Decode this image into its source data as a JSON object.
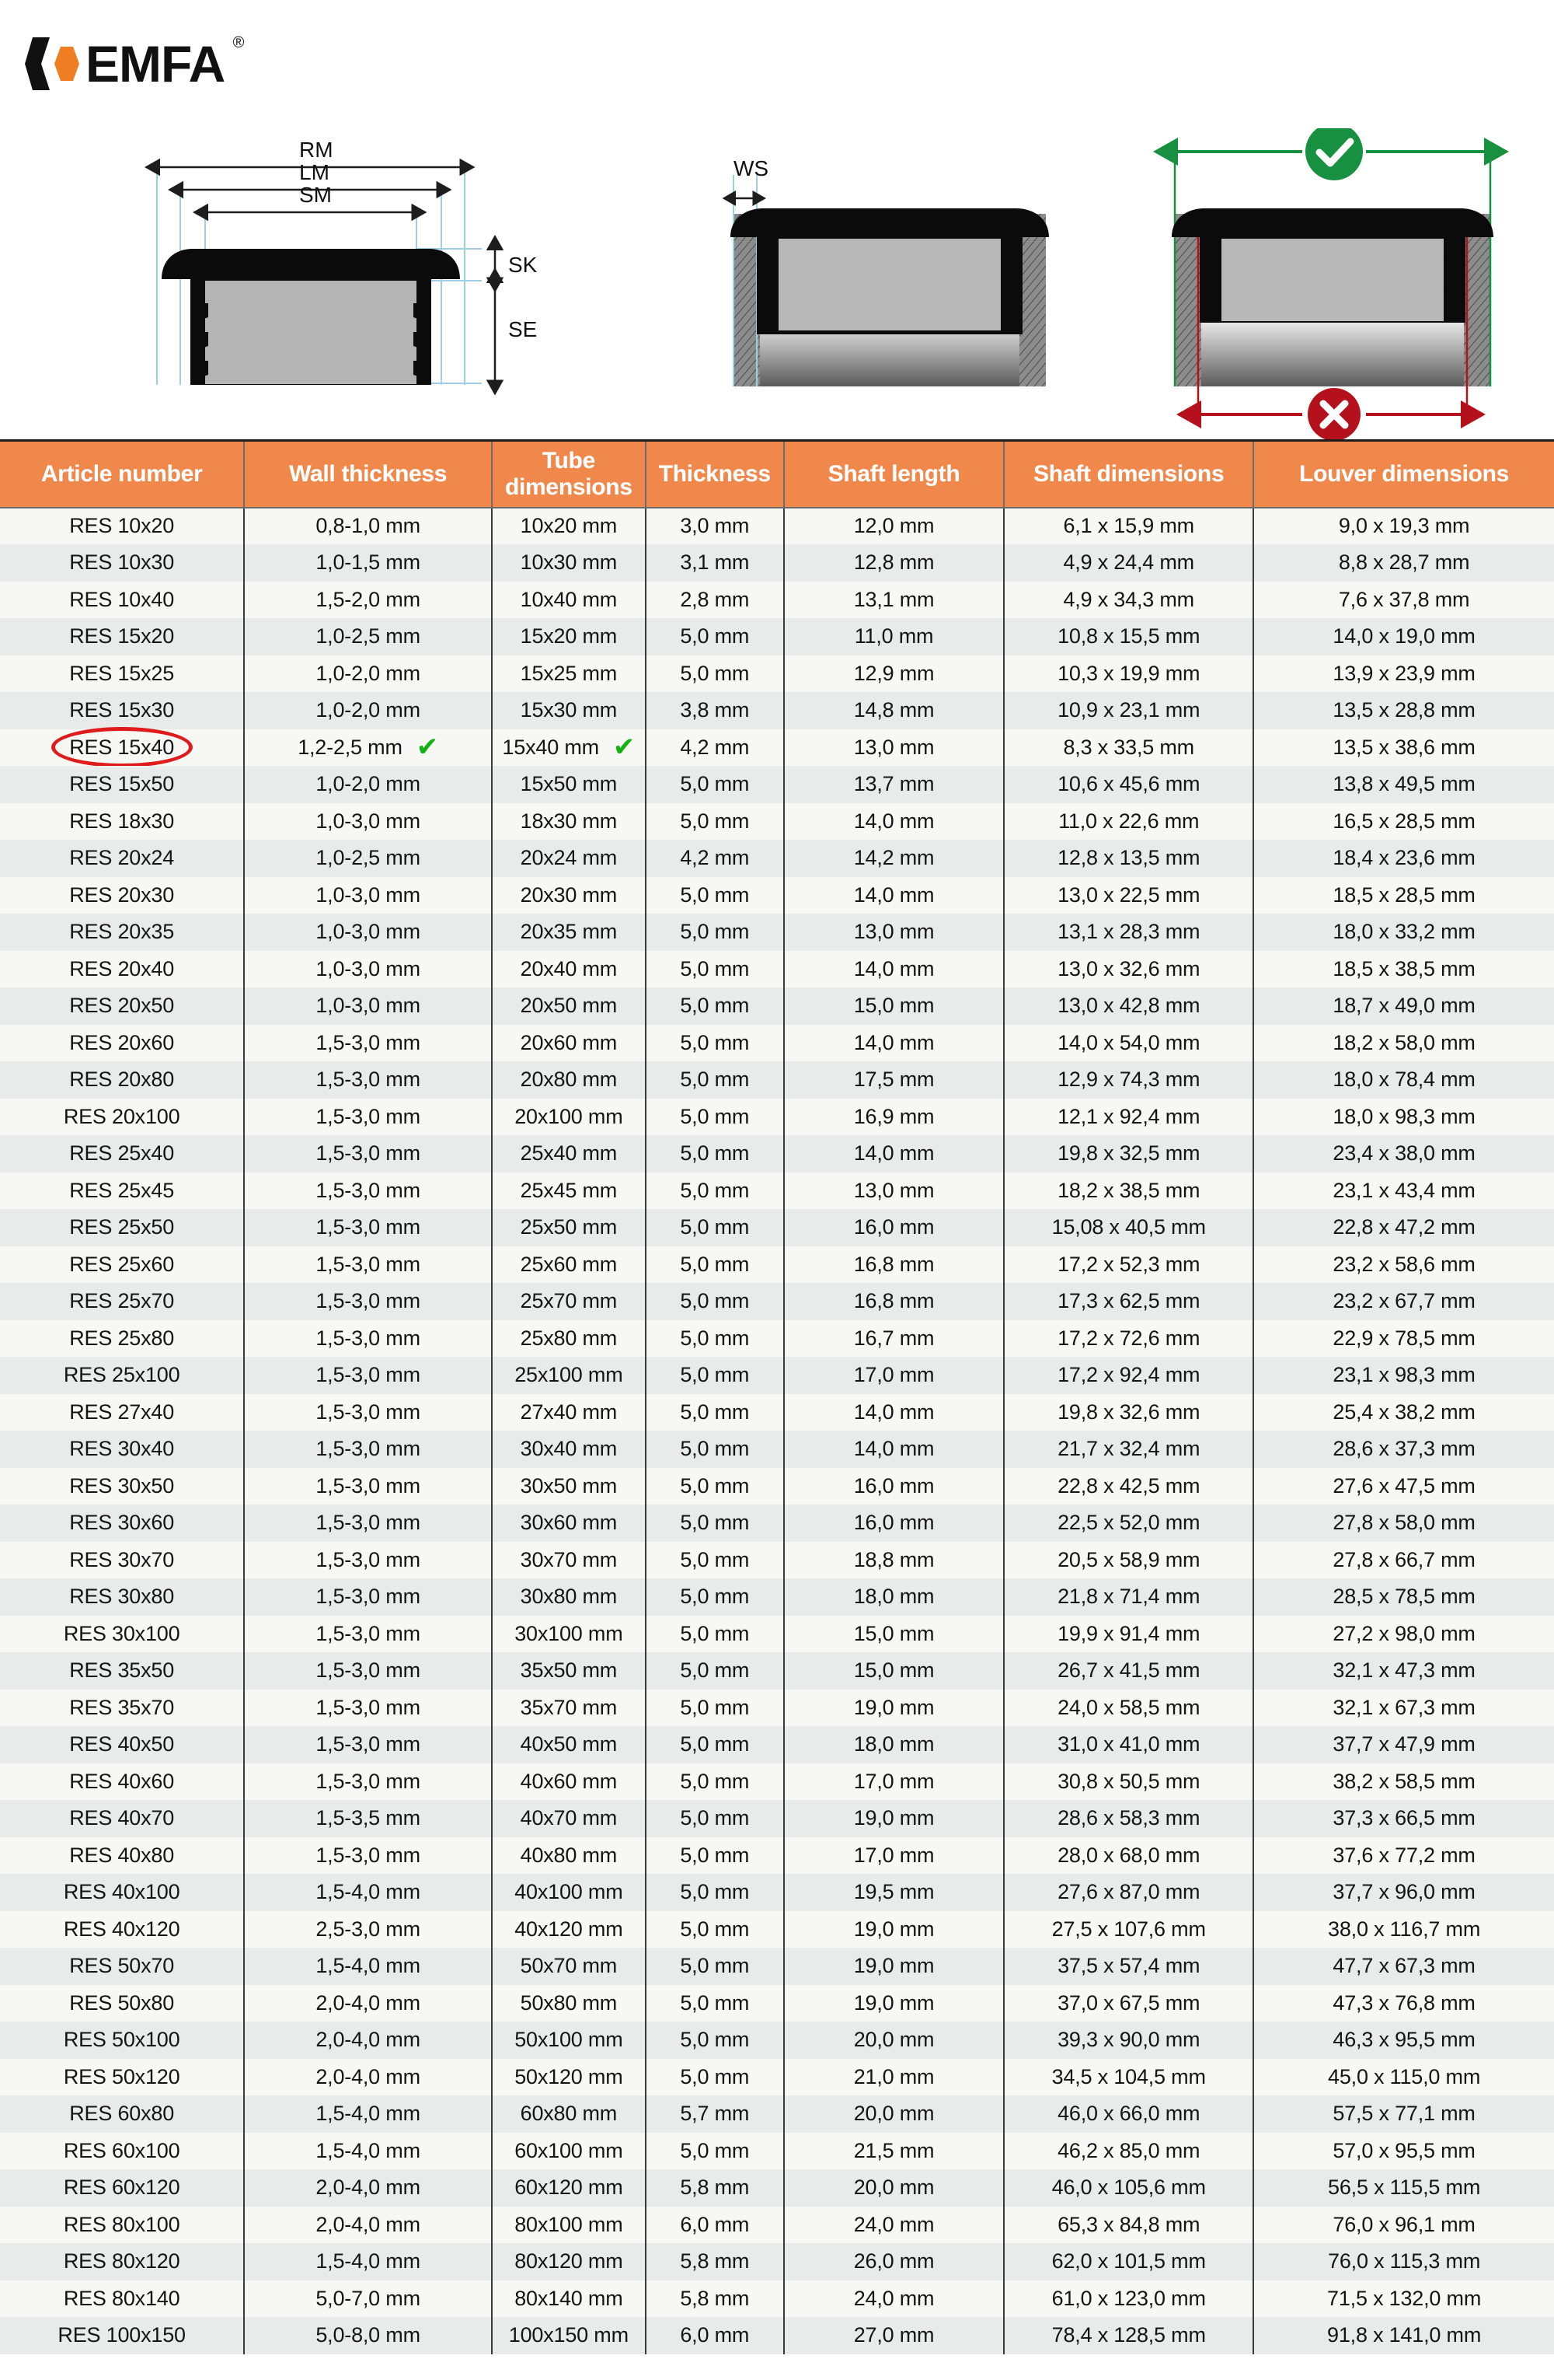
{
  "brand": {
    "name": "EMFA",
    "registered_mark": "®",
    "logo_icon": "emfa-hexagon-logo",
    "accent_color": "#f0884c",
    "logo_orange": "#ef7d22"
  },
  "diagrams": {
    "side_view": {
      "name": "cross-section-side-view",
      "labels": [
        "RM",
        "LM",
        "SM",
        "SK",
        "SE"
      ]
    },
    "wall_view": {
      "name": "wall-thickness-view",
      "labels": [
        "WS"
      ]
    },
    "fit_view": {
      "name": "correct-incorrect-measurement-view",
      "ok_icon": "green-check-circle-icon",
      "ok_color": "#1a8a3c",
      "not_ok_icon": "red-cross-circle-icon",
      "not_ok_color": "#b4111d",
      "labels": []
    }
  },
  "table": {
    "columns": [
      "Article number",
      "Wall thickness",
      "Tube dimensions",
      "Thickness",
      "Shaft length",
      "Shaft dimensions",
      "Louver dimensions"
    ],
    "highlight": {
      "article": "RES 15x40",
      "marker": "red-ellipse",
      "marker_color": "#e01b1b",
      "check_mark": "✔",
      "check_color": "#13b213",
      "checked_columns": [
        "Wall thickness",
        "Tube dimensions"
      ]
    },
    "rows": [
      [
        "RES 10x20",
        "0,8-1,0 mm",
        "10x20 mm",
        "3,0 mm",
        "12,0 mm",
        "6,1 x 15,9 mm",
        "9,0 x 19,3 mm"
      ],
      [
        "RES 10x30",
        "1,0-1,5 mm",
        "10x30 mm",
        "3,1 mm",
        "12,8 mm",
        "4,9 x 24,4 mm",
        "8,8 x 28,7 mm"
      ],
      [
        "RES 10x40",
        "1,5-2,0 mm",
        "10x40 mm",
        "2,8 mm",
        "13,1 mm",
        "4,9 x 34,3 mm",
        "7,6 x 37,8 mm"
      ],
      [
        "RES 15x20",
        "1,0-2,5 mm",
        "15x20 mm",
        "5,0 mm",
        "11,0 mm",
        "10,8 x 15,5 mm",
        "14,0 x 19,0 mm"
      ],
      [
        "RES 15x25",
        "1,0-2,0 mm",
        "15x25 mm",
        "5,0 mm",
        "12,9 mm",
        "10,3 x 19,9 mm",
        "13,9 x 23,9 mm"
      ],
      [
        "RES 15x30",
        "1,0-2,0 mm",
        "15x30 mm",
        "3,8 mm",
        "14,8 mm",
        "10,9 x 23,1 mm",
        "13,5 x 28,8 mm"
      ],
      [
        "RES 15x40",
        "1,2-2,5 mm",
        "15x40 mm",
        "4,2 mm",
        "13,0 mm",
        "8,3 x 33,5 mm",
        "13,5 x 38,6 mm"
      ],
      [
        "RES 15x50",
        "1,0-2,0 mm",
        "15x50 mm",
        "5,0 mm",
        "13,7 mm",
        "10,6 x 45,6 mm",
        "13,8 x 49,5 mm"
      ],
      [
        "RES 18x30",
        "1,0-3,0 mm",
        "18x30 mm",
        "5,0 mm",
        "14,0 mm",
        "11,0 x 22,6 mm",
        "16,5 x 28,5 mm"
      ],
      [
        "RES 20x24",
        "1,0-2,5 mm",
        "20x24 mm",
        "4,2 mm",
        "14,2 mm",
        "12,8 x 13,5 mm",
        "18,4 x 23,6 mm"
      ],
      [
        "RES 20x30",
        "1,0-3,0 mm",
        "20x30 mm",
        "5,0 mm",
        "14,0 mm",
        "13,0 x 22,5 mm",
        "18,5 x 28,5 mm"
      ],
      [
        "RES 20x35",
        "1,0-3,0 mm",
        "20x35 mm",
        "5,0 mm",
        "13,0 mm",
        "13,1 x 28,3 mm",
        "18,0 x 33,2 mm"
      ],
      [
        "RES 20x40",
        "1,0-3,0 mm",
        "20x40 mm",
        "5,0 mm",
        "14,0 mm",
        "13,0 x 32,6 mm",
        "18,5 x 38,5 mm"
      ],
      [
        "RES 20x50",
        "1,0-3,0 mm",
        "20x50 mm",
        "5,0 mm",
        "15,0 mm",
        "13,0 x 42,8 mm",
        "18,7 x 49,0 mm"
      ],
      [
        "RES 20x60",
        "1,5-3,0 mm",
        "20x60 mm",
        "5,0 mm",
        "14,0 mm",
        "14,0 x 54,0 mm",
        "18,2 x 58,0 mm"
      ],
      [
        "RES 20x80",
        "1,5-3,0 mm",
        "20x80 mm",
        "5,0 mm",
        "17,5 mm",
        "12,9 x 74,3 mm",
        "18,0 x 78,4 mm"
      ],
      [
        "RES 20x100",
        "1,5-3,0 mm",
        "20x100 mm",
        "5,0 mm",
        "16,9 mm",
        "12,1 x 92,4 mm",
        "18,0 x 98,3 mm"
      ],
      [
        "RES 25x40",
        "1,5-3,0 mm",
        "25x40 mm",
        "5,0 mm",
        "14,0 mm",
        "19,8 x 32,5 mm",
        "23,4 x 38,0 mm"
      ],
      [
        "RES 25x45",
        "1,5-3,0 mm",
        "25x45 mm",
        "5,0 mm",
        "13,0 mm",
        "18,2 x 38,5 mm",
        "23,1 x 43,4 mm"
      ],
      [
        "RES 25x50",
        "1,5-3,0 mm",
        "25x50 mm",
        "5,0 mm",
        "16,0 mm",
        "15,08 x 40,5 mm",
        "22,8 x 47,2 mm"
      ],
      [
        "RES 25x60",
        "1,5-3,0 mm",
        "25x60 mm",
        "5,0 mm",
        "16,8 mm",
        "17,2 x 52,3 mm",
        "23,2 x 58,6 mm"
      ],
      [
        "RES 25x70",
        "1,5-3,0 mm",
        "25x70 mm",
        "5,0 mm",
        "16,8 mm",
        "17,3 x 62,5 mm",
        "23,2 x 67,7 mm"
      ],
      [
        "RES 25x80",
        "1,5-3,0 mm",
        "25x80 mm",
        "5,0 mm",
        "16,7 mm",
        "17,2 x 72,6 mm",
        "22,9 x 78,5 mm"
      ],
      [
        "RES 25x100",
        "1,5-3,0 mm",
        "25x100 mm",
        "5,0 mm",
        "17,0 mm",
        "17,2 x 92,4 mm",
        "23,1 x 98,3 mm"
      ],
      [
        "RES 27x40",
        "1,5-3,0 mm",
        "27x40 mm",
        "5,0 mm",
        "14,0 mm",
        "19,8 x 32,6 mm",
        "25,4 x 38,2 mm"
      ],
      [
        "RES 30x40",
        "1,5-3,0 mm",
        "30x40 mm",
        "5,0 mm",
        "14,0 mm",
        "21,7 x 32,4 mm",
        "28,6 x 37,3 mm"
      ],
      [
        "RES 30x50",
        "1,5-3,0 mm",
        "30x50 mm",
        "5,0 mm",
        "16,0 mm",
        "22,8 x 42,5 mm",
        "27,6 x 47,5 mm"
      ],
      [
        "RES 30x60",
        "1,5-3,0 mm",
        "30x60 mm",
        "5,0 mm",
        "16,0 mm",
        "22,5 x 52,0 mm",
        "27,8 x 58,0 mm"
      ],
      [
        "RES 30x70",
        "1,5-3,0 mm",
        "30x70 mm",
        "5,0 mm",
        "18,8 mm",
        "20,5 x 58,9 mm",
        "27,8 x 66,7 mm"
      ],
      [
        "RES 30x80",
        "1,5-3,0 mm",
        "30x80 mm",
        "5,0 mm",
        "18,0 mm",
        "21,8 x 71,4 mm",
        "28,5 x 78,5 mm"
      ],
      [
        "RES 30x100",
        "1,5-3,0 mm",
        "30x100 mm",
        "5,0 mm",
        "15,0 mm",
        "19,9 x 91,4 mm",
        "27,2 x 98,0 mm"
      ],
      [
        "RES 35x50",
        "1,5-3,0 mm",
        "35x50 mm",
        "5,0 mm",
        "15,0 mm",
        "26,7 x 41,5 mm",
        "32,1 x 47,3 mm"
      ],
      [
        "RES 35x70",
        "1,5-3,0 mm",
        "35x70 mm",
        "5,0 mm",
        "19,0 mm",
        "24,0 x 58,5 mm",
        "32,1 x 67,3 mm"
      ],
      [
        "RES 40x50",
        "1,5-3,0 mm",
        "40x50 mm",
        "5,0 mm",
        "18,0 mm",
        "31,0 x 41,0 mm",
        "37,7 x 47,9 mm"
      ],
      [
        "RES 40x60",
        "1,5-3,0 mm",
        "40x60 mm",
        "5,0 mm",
        "17,0 mm",
        "30,8 x 50,5 mm",
        "38,2 x 58,5 mm"
      ],
      [
        "RES 40x70",
        "1,5-3,5 mm",
        "40x70 mm",
        "5,0 mm",
        "19,0 mm",
        "28,6 x 58,3 mm",
        "37,3 x 66,5 mm"
      ],
      [
        "RES 40x80",
        "1,5-3,0 mm",
        "40x80 mm",
        "5,0 mm",
        "17,0 mm",
        "28,0 x 68,0 mm",
        "37,6 x 77,2 mm"
      ],
      [
        "RES 40x100",
        "1,5-4,0 mm",
        "40x100 mm",
        "5,0 mm",
        "19,5 mm",
        "27,6 x 87,0 mm",
        "37,7 x 96,0 mm"
      ],
      [
        "RES 40x120",
        "2,5-3,0 mm",
        "40x120 mm",
        "5,0 mm",
        "19,0 mm",
        "27,5 x 107,6 mm",
        "38,0 x 116,7 mm"
      ],
      [
        "RES 50x70",
        "1,5-4,0 mm",
        "50x70 mm",
        "5,0 mm",
        "19,0 mm",
        "37,5 x 57,4 mm",
        "47,7 x 67,3 mm"
      ],
      [
        "RES 50x80",
        "2,0-4,0 mm",
        "50x80 mm",
        "5,0 mm",
        "19,0 mm",
        "37,0 x 67,5 mm",
        "47,3 x 76,8 mm"
      ],
      [
        "RES 50x100",
        "2,0-4,0 mm",
        "50x100 mm",
        "5,0 mm",
        "20,0 mm",
        "39,3 x 90,0 mm",
        "46,3 x 95,5 mm"
      ],
      [
        "RES 50x120",
        "2,0-4,0 mm",
        "50x120 mm",
        "5,0 mm",
        "21,0 mm",
        "34,5 x 104,5 mm",
        "45,0 x 115,0 mm"
      ],
      [
        "RES 60x80",
        "1,5-4,0 mm",
        "60x80 mm",
        "5,7 mm",
        "20,0 mm",
        "46,0 x 66,0 mm",
        "57,5 x 77,1 mm"
      ],
      [
        "RES 60x100",
        "1,5-4,0 mm",
        "60x100 mm",
        "5,0 mm",
        "21,5 mm",
        "46,2 x 85,0 mm",
        "57,0 x 95,5 mm"
      ],
      [
        "RES 60x120",
        "2,0-4,0 mm",
        "60x120 mm",
        "5,8 mm",
        "20,0 mm",
        "46,0 x 105,6 mm",
        "56,5 x 115,5 mm"
      ],
      [
        "RES 80x100",
        "2,0-4,0 mm",
        "80x100 mm",
        "6,0 mm",
        "24,0 mm",
        "65,3 x 84,8 mm",
        "76,0 x 96,1 mm"
      ],
      [
        "RES 80x120",
        "1,5-4,0 mm",
        "80x120 mm",
        "5,8 mm",
        "26,0 mm",
        "62,0 x 101,5 mm",
        "76,0 x 115,3 mm"
      ],
      [
        "RES 80x140",
        "5,0-7,0 mm",
        "80x140 mm",
        "5,8 mm",
        "24,0 mm",
        "61,0 x 123,0 mm",
        "71,5 x 132,0 mm"
      ],
      [
        "RES 100x150",
        "5,0-8,0 mm",
        "100x150 mm",
        "6,0 mm",
        "27,0 mm",
        "78,4 x 128,5 mm",
        "91,8 x 141,0 mm"
      ]
    ]
  }
}
